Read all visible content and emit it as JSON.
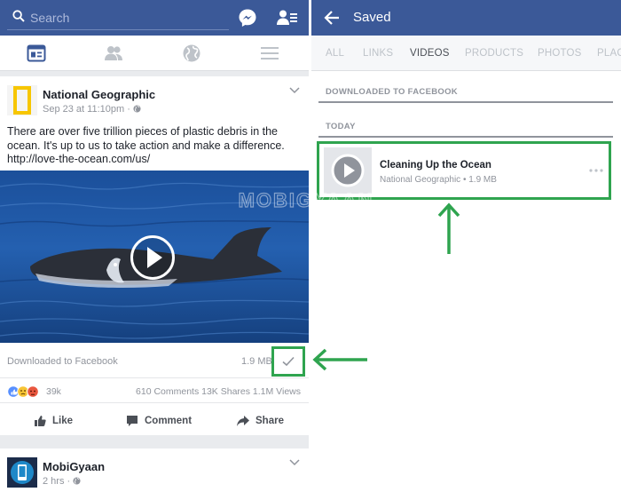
{
  "left": {
    "search": {
      "placeholder": "Search"
    },
    "post1": {
      "author": "National Geographic",
      "meta": "Sep 23 at 11:10pm · ",
      "text": "There are over five trillion pieces of plastic debris in the ocean. It's up to us to take action and make a difference.",
      "link": "http://love-the-ocean.com/us/",
      "download_label": "Downloaded to Facebook",
      "download_size": "1.9 MB",
      "reaction_count": "39k",
      "stats": "610 Comments  13K Shares  1.1M Views",
      "actions": {
        "like": "Like",
        "comment": "Comment",
        "share": "Share"
      }
    },
    "post2": {
      "author": "MobiGyaan",
      "meta": "2 hrs · "
    }
  },
  "right": {
    "title": "Saved",
    "tabs": [
      "ALL",
      "LINKS",
      "VIDEOS",
      "PRODUCTS",
      "PHOTOS",
      "PLAC"
    ],
    "active_tab": "VIDEOS",
    "sections": {
      "downloaded": "DOWNLOADED TO FACEBOOK",
      "today": "TODAY"
    },
    "item": {
      "title": "Cleaning Up the Ocean",
      "subtitle": "National Geographic • 1.9 MB"
    }
  },
  "watermark": "MOBIGYAAN",
  "colors": {
    "brand": "#3b5998",
    "highlight": "#2fa44f"
  },
  "icons": [
    "search-icon",
    "messenger-icon",
    "friend-requests-icon",
    "news-feed-icon",
    "friends-icon",
    "globe-icon",
    "menu-icon",
    "play-icon",
    "check-icon",
    "like-icon",
    "comment-icon",
    "share-icon",
    "back-arrow-icon",
    "more-dots-icon"
  ]
}
